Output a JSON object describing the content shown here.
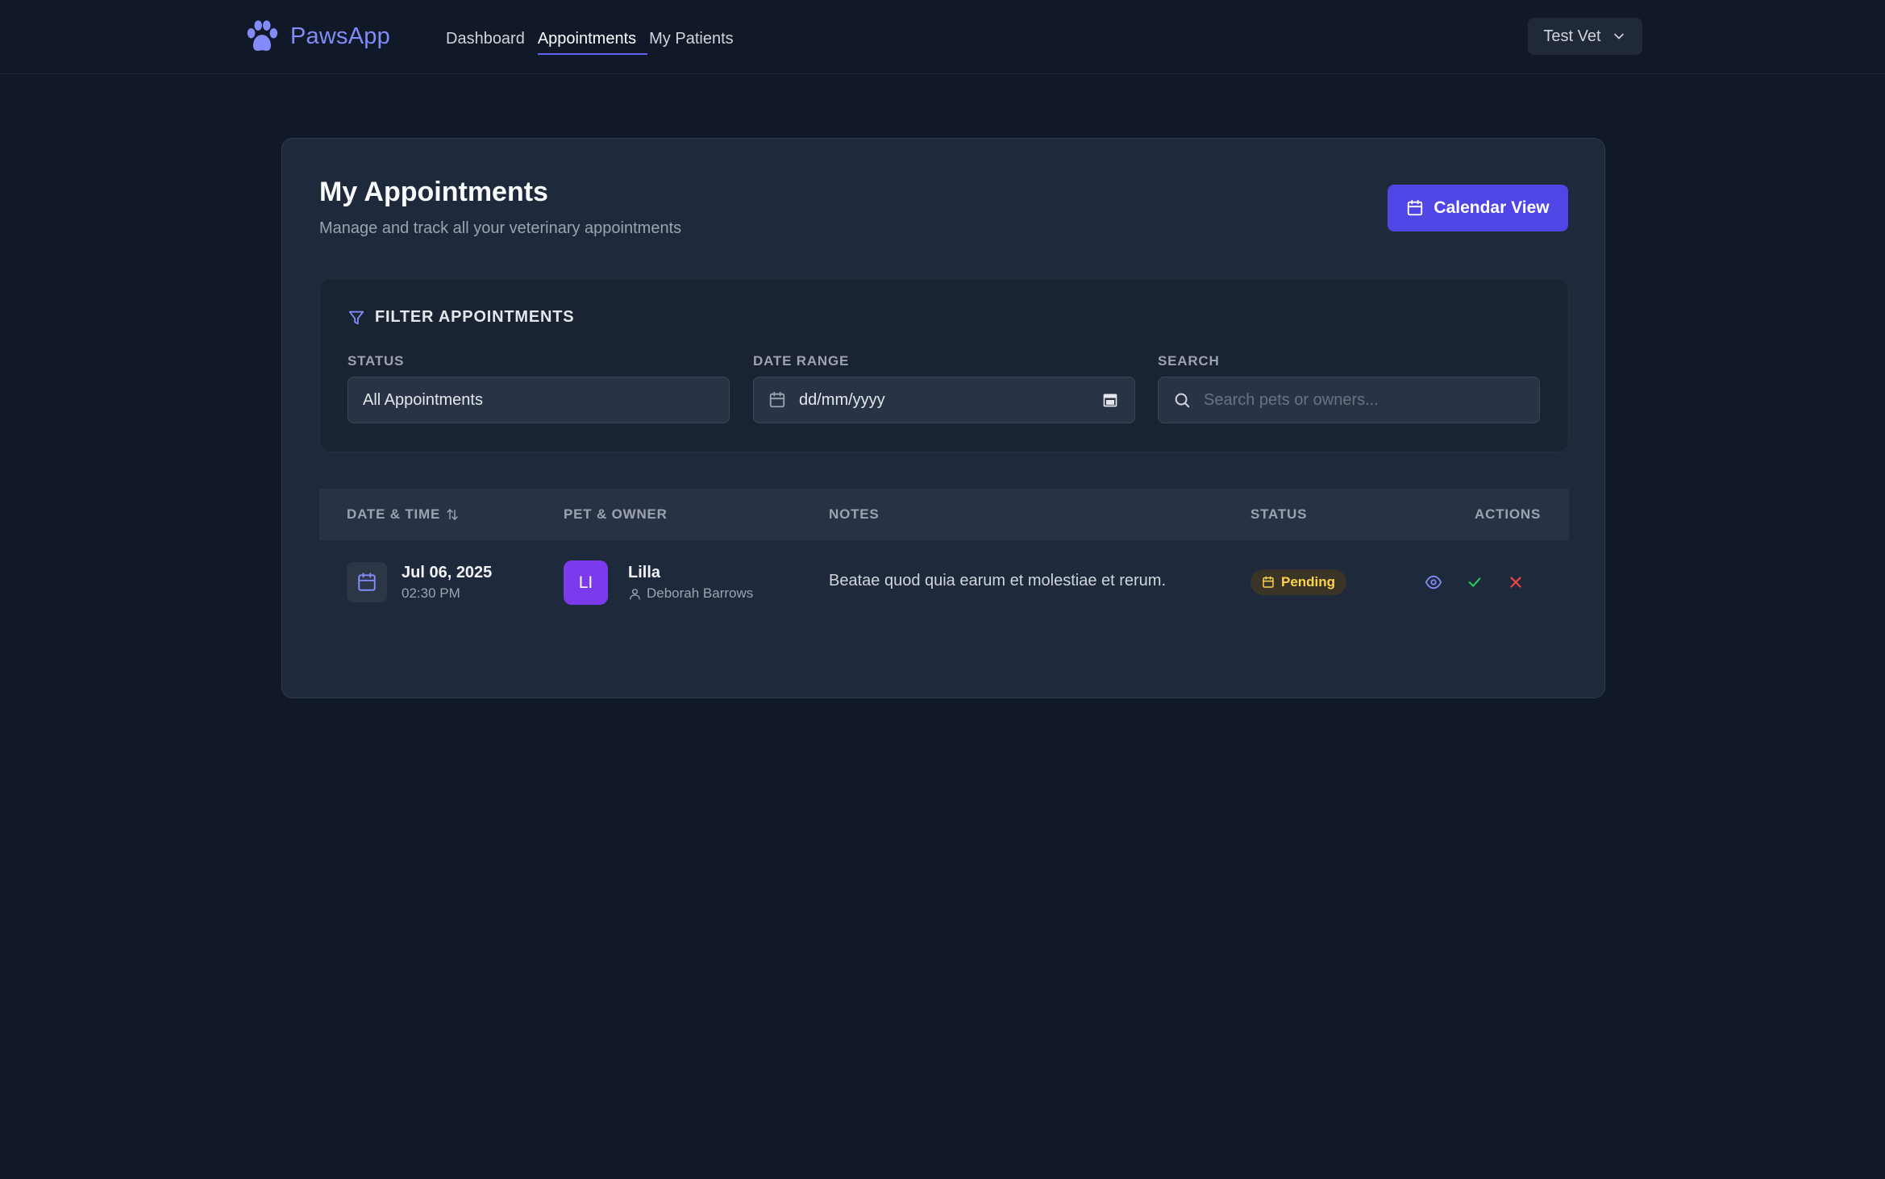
{
  "app": {
    "name": "PawsApp",
    "logo_icon": "paw-icon"
  },
  "nav": {
    "items": [
      {
        "label": "Dashboard",
        "active": false
      },
      {
        "label": "Appointments",
        "active": true
      },
      {
        "label": "My Patients",
        "active": false
      }
    ]
  },
  "user_menu": {
    "label": "Test Vet",
    "icon": "chevron-down-icon"
  },
  "header": {
    "title": "My Appointments",
    "subtitle": "Manage and track all your veterinary appointments",
    "calendar_button": "Calendar View"
  },
  "filters": {
    "title": "FILTER APPOINTMENTS",
    "status": {
      "label": "STATUS",
      "value": "All Appointments"
    },
    "date_range": {
      "label": "DATE RANGE",
      "value": "dd/mm/yyyy"
    },
    "search": {
      "label": "SEARCH",
      "placeholder": "Search pets or owners..."
    }
  },
  "table": {
    "columns": [
      "DATE & TIME",
      "PET & OWNER",
      "NOTES",
      "STATUS",
      "ACTIONS"
    ],
    "rows": [
      {
        "date": "Jul 06, 2025",
        "time": "02:30 PM",
        "pet_initials": "LI",
        "pet_name": "Lilla",
        "owner": "Deborah Barrows",
        "notes": "Beatae quod quia earum et molestiae et rerum.",
        "status": "Pending"
      }
    ]
  },
  "colors": {
    "background": "#111827",
    "card": "#1e293b",
    "accent": "#4f46e5",
    "brand": "#818cf8",
    "avatar": "#7c3aed",
    "pending": "#fcd34d",
    "approve": "#22c55e",
    "reject": "#ef4444"
  }
}
